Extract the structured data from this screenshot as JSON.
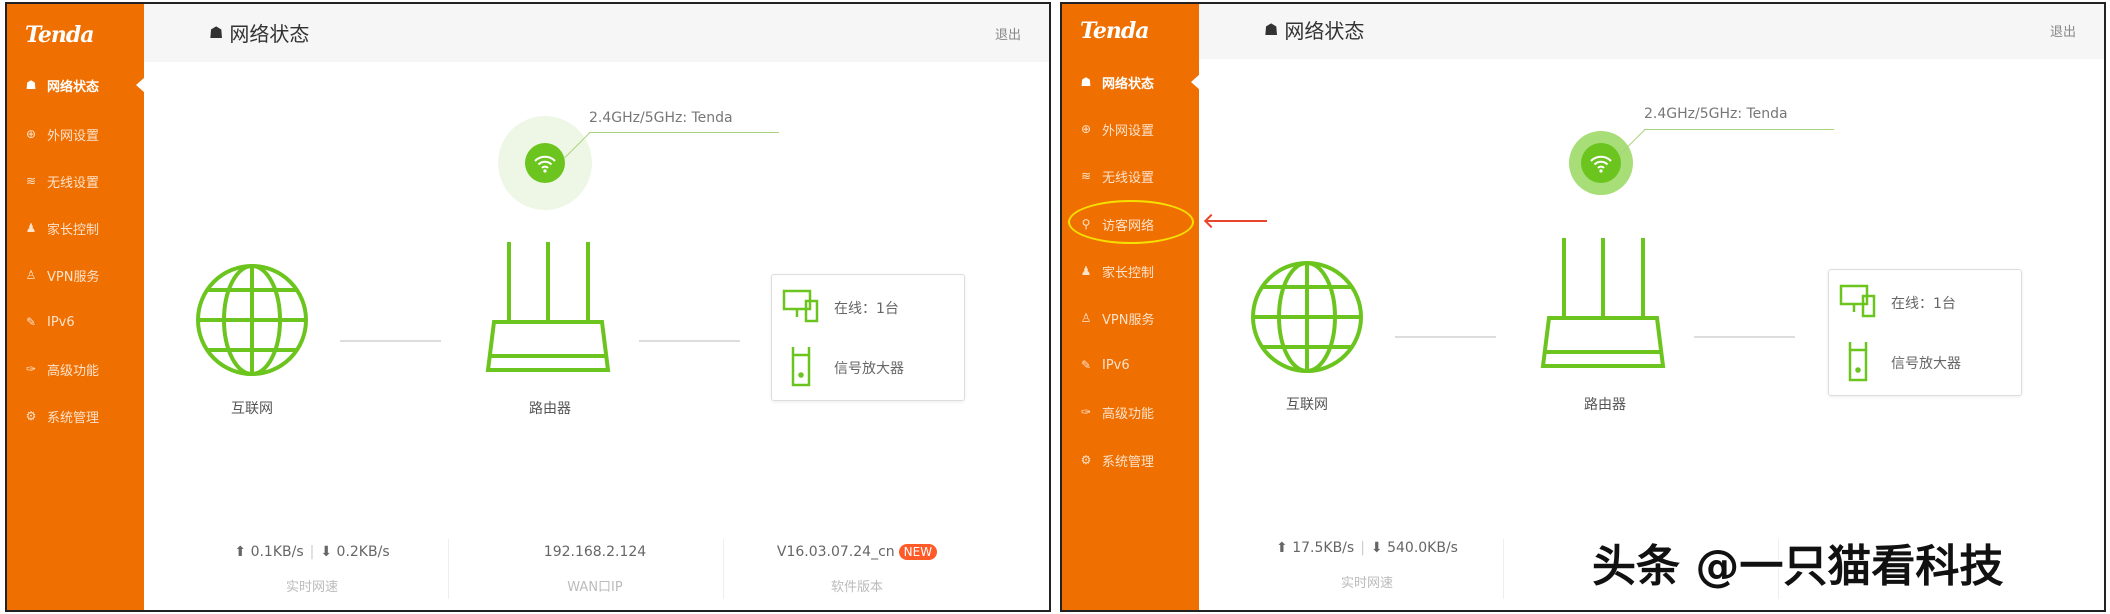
{
  "brand": {
    "logo": "Tenda",
    "accent": "#ef6f00",
    "green": "#6cc51e"
  },
  "header": {
    "title": "网络状态",
    "logout": "退出"
  },
  "left": {
    "menu": [
      "网络状态",
      "外网设置",
      "无线设置",
      "家长控制",
      "VPN服务",
      "IPv6",
      "高级功能",
      "系统管理"
    ],
    "ssid": "2.4GHz/5GHz: Tenda",
    "internet_label": "互联网",
    "router_label": "路由器",
    "online": "在线：1台",
    "extender": "信号放大器",
    "upload": "0.1KB/s",
    "download": "0.2KB/s",
    "speed_label": "实时网速",
    "wan_ip": "192.168.2.124",
    "wan_label": "WAN口IP",
    "version": "V16.03.07.24_cn",
    "new_badge": "NEW",
    "version_label": "软件版本"
  },
  "right": {
    "menu": [
      "网络状态",
      "外网设置",
      "无线设置",
      "访客网络",
      "家长控制",
      "VPN服务",
      "IPv6",
      "高级功能",
      "系统管理"
    ],
    "ssid": "2.4GHz/5GHz: Tenda",
    "internet_label": "互联网",
    "router_label": "路由器",
    "online": "在线：1台",
    "extender": "信号放大器",
    "upload": "17.5KB/s",
    "download": "540.0KB/s",
    "speed_label": "实时网速"
  },
  "watermark": "头条 @一只猫看科技"
}
